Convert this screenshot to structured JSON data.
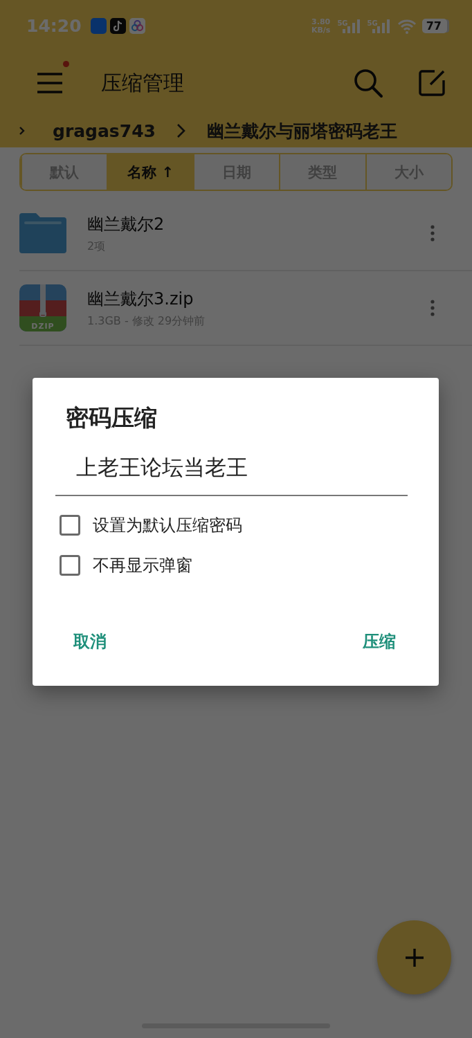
{
  "status_bar": {
    "time": "14:20",
    "net_speed": "3.80",
    "net_unit": "KB/s",
    "signals": [
      "5G",
      "5G"
    ],
    "battery": "77"
  },
  "header": {
    "title": "压缩管理",
    "menu_badge": true
  },
  "breadcrumb": [
    "gragas743",
    "幽兰戴尔与丽塔密码老王"
  ],
  "sort_tabs": [
    {
      "label": "默认",
      "selected": false
    },
    {
      "label": "名称 ↑",
      "selected": true
    },
    {
      "label": "日期",
      "selected": false
    },
    {
      "label": "类型",
      "selected": false
    },
    {
      "label": "大小",
      "selected": false
    }
  ],
  "files": [
    {
      "kind": "folder",
      "name": "幽兰戴尔2",
      "meta": "2项"
    },
    {
      "kind": "zip",
      "name": "幽兰戴尔3.zip",
      "meta": "1.3GB - 修改 29分钟前",
      "icon_label": "DZIP"
    }
  ],
  "dialog": {
    "title": "密码压缩",
    "value": "上老王论坛当老王",
    "options": [
      {
        "label": "设置为默认压缩密码",
        "checked": false
      },
      {
        "label": "不再显示弹窗",
        "checked": false
      }
    ],
    "buttons": [
      "取消",
      "压缩"
    ]
  }
}
